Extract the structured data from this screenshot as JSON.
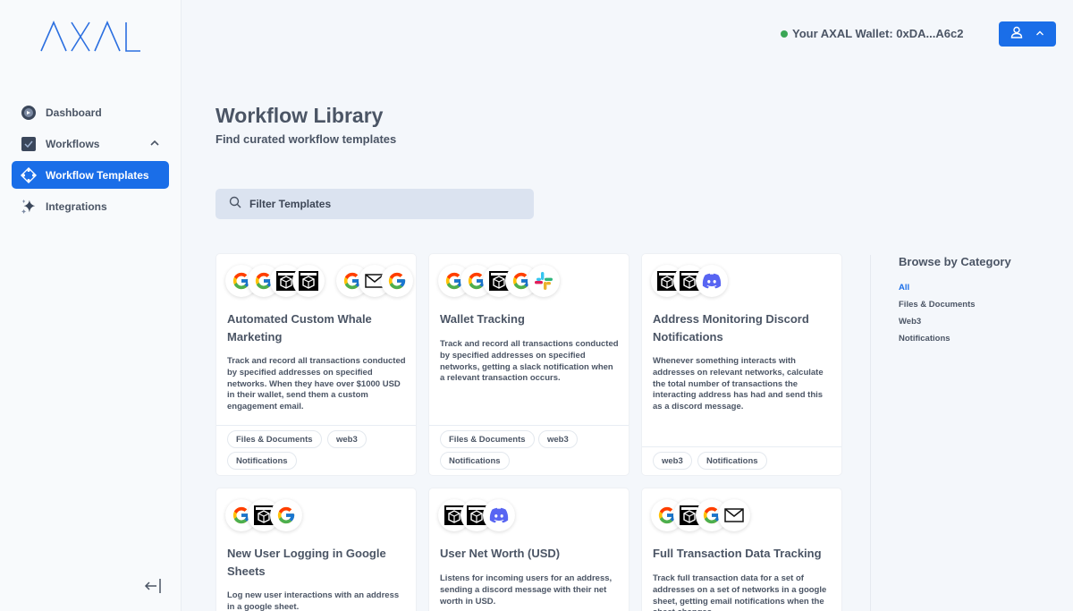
{
  "brand": {
    "logo_text": "AXAL"
  },
  "colors": {
    "accent": "#1a6ee8",
    "status_online": "#3aa655",
    "text": "#4b5565"
  },
  "sidebar": {
    "items": [
      {
        "label": "Dashboard",
        "icon": "dashboard-icon"
      },
      {
        "label": "Workflows",
        "icon": "workflows-icon",
        "expanded": true
      },
      {
        "label": "Workflow Templates",
        "icon": "templates-icon",
        "active": true
      },
      {
        "label": "Integrations",
        "icon": "sparkle-icon"
      }
    ]
  },
  "header": {
    "wallet_text": "Your AXAL Wallet: 0xDA...A6c2"
  },
  "main": {
    "title": "Workflow Library",
    "subtitle": "Find curated workflow templates",
    "filter_placeholder": "Filter Templates"
  },
  "cards": [
    {
      "title": "Automated Custom Whale Marketing",
      "description": "Track and record all transactions conducted by specified addresses on specified networks. When they have over $1000 USD in their wallet, send them a custom engagement email.",
      "icons": [
        "google-icon",
        "google-icon",
        "chain-icon",
        "chain-icon",
        "google-icon",
        "mail-icon",
        "google-icon"
      ],
      "tags": [
        "Files & Documents",
        "web3",
        "Notifications"
      ]
    },
    {
      "title": "Wallet Tracking",
      "description": "Track and record all transactions conducted by specified addresses on specified networks, getting a slack notification when a relevant transaction occurs.",
      "icons": [
        "google-icon",
        "google-icon",
        "chain-icon",
        "google-icon",
        "slack-icon"
      ],
      "tags": [
        "Files & Documents",
        "web3",
        "Notifications"
      ]
    },
    {
      "title": "Address Monitoring Discord Notifications",
      "description": "Whenever something interacts with addresses on relevant networks, calculate the total number of transactions the interacting address has had and send this as a discord message.",
      "icons": [
        "chain-icon",
        "chain-icon",
        "discord-icon"
      ],
      "tags": [
        "web3",
        "Notifications"
      ]
    },
    {
      "title": "New User Logging in Google Sheets",
      "description": "Log new user interactions with an address in a google sheet.",
      "icons": [
        "google-icon",
        "chain-icon",
        "google-icon"
      ],
      "tags": []
    },
    {
      "title": "User Net Worth (USD)",
      "description": "Listens for incoming users for an address, sending a discord message with their net worth in USD.",
      "icons": [
        "chain-icon",
        "chain-icon",
        "discord-icon"
      ],
      "tags": []
    },
    {
      "title": "Full Transaction Data Tracking",
      "description": "Track full transaction data for a set of addresses on a set of networks in a google sheet, getting email notifications when the sheet changes.",
      "icons": [
        "google-icon",
        "chain-icon",
        "google-icon",
        "mail-icon"
      ],
      "tags": []
    }
  ],
  "categories": {
    "title": "Browse by Category",
    "items": [
      "All",
      "Files & Documents",
      "Web3",
      "Notifications"
    ]
  }
}
